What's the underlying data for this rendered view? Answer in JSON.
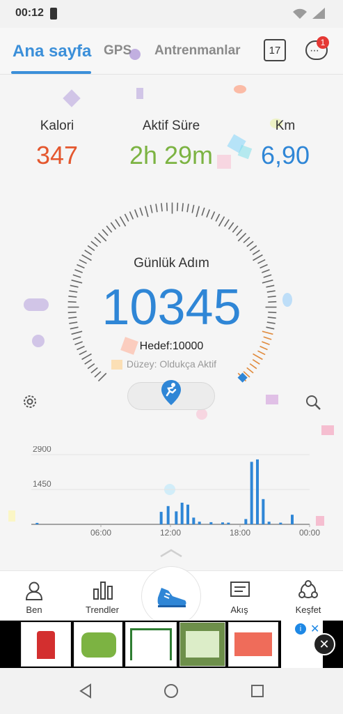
{
  "status_bar": {
    "time": "00:12"
  },
  "tabs": [
    {
      "label": "Ana sayfa"
    },
    {
      "label": "GPS"
    },
    {
      "label": "Antrenmanlar"
    }
  ],
  "calendar": {
    "day": "17"
  },
  "notifications": {
    "count": "1"
  },
  "stats": {
    "calories_label": "Kalori",
    "calories_value": "347",
    "active_label": "Aktif Süre",
    "active_value": "2h 29m",
    "km_label": "Km",
    "km_value": "6,90"
  },
  "steps": {
    "title": "Günlük Adım",
    "value": "10345",
    "goal": "Hedef:10000",
    "level": "Düzey: Oldukça Aktif"
  },
  "colors": {
    "accent": "#3b8fd9",
    "calories": "#e4572e",
    "active": "#7cb342",
    "km": "#2f86d6"
  },
  "chart_data": {
    "type": "bar",
    "y_ticks": [
      "2900",
      "1450"
    ],
    "x_ticks": [
      "06:00",
      "12:00",
      "18:00",
      "00:00"
    ],
    "ylim": [
      0,
      2900
    ],
    "hours_span": [
      0,
      24
    ],
    "bars": [
      {
        "t": 0.5,
        "v": 60
      },
      {
        "t": 11.2,
        "v": 520
      },
      {
        "t": 11.8,
        "v": 760
      },
      {
        "t": 12.5,
        "v": 540
      },
      {
        "t": 13.0,
        "v": 900
      },
      {
        "t": 13.5,
        "v": 820
      },
      {
        "t": 14.0,
        "v": 280
      },
      {
        "t": 14.5,
        "v": 110
      },
      {
        "t": 15.5,
        "v": 90
      },
      {
        "t": 16.5,
        "v": 80
      },
      {
        "t": 17.0,
        "v": 70
      },
      {
        "t": 18.5,
        "v": 220
      },
      {
        "t": 19.0,
        "v": 2600
      },
      {
        "t": 19.5,
        "v": 2700
      },
      {
        "t": 20.0,
        "v": 1050
      },
      {
        "t": 20.5,
        "v": 110
      },
      {
        "t": 21.5,
        "v": 70
      },
      {
        "t": 22.5,
        "v": 400
      }
    ]
  },
  "bottom_nav": [
    {
      "label": "Ben"
    },
    {
      "label": "Trendler"
    },
    {
      "label": "Akış"
    },
    {
      "label": "Keşfet"
    }
  ]
}
